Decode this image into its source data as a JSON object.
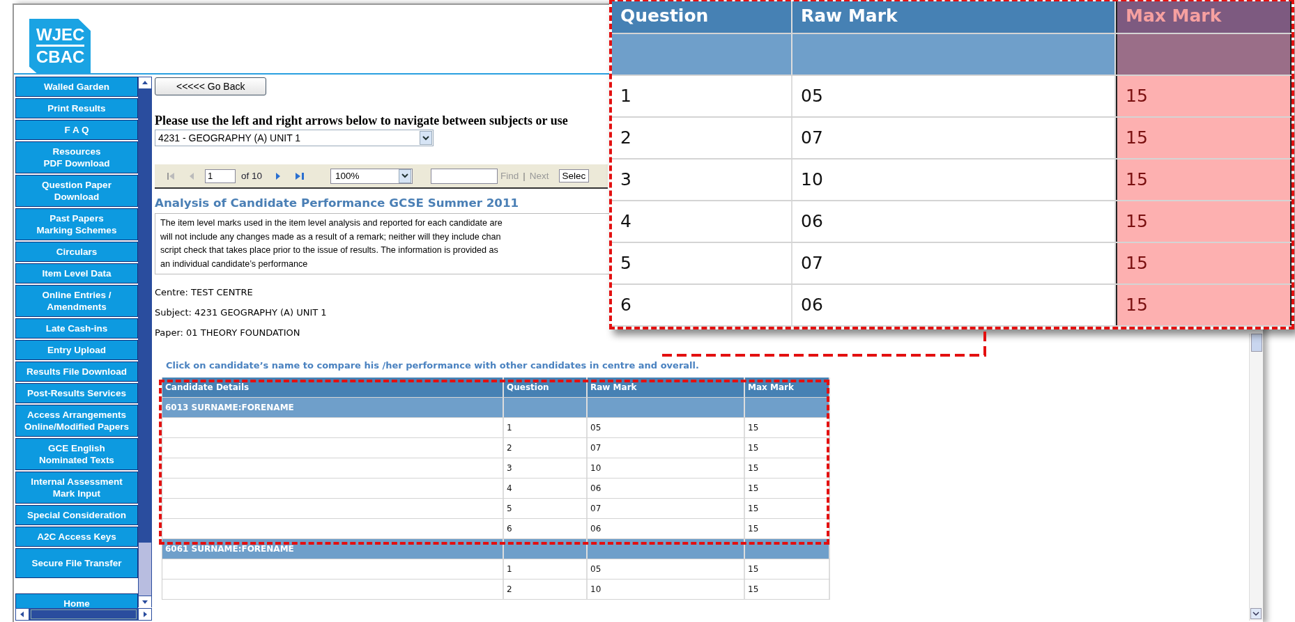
{
  "logo": {
    "lines": [
      "WJEC",
      "CBAC"
    ]
  },
  "sidebar": {
    "items": [
      {
        "label": "Walled Garden"
      },
      {
        "label": "Print Results"
      },
      {
        "label": "F A Q"
      },
      {
        "label": "Resources\nPDF Download"
      },
      {
        "label": "Question Paper\nDownload"
      },
      {
        "label": "Past Papers\nMarking Schemes"
      },
      {
        "label": "Circulars"
      },
      {
        "label": "Item Level Data"
      },
      {
        "label": "Online Entries /\nAmendments"
      },
      {
        "label": "Late Cash-ins"
      },
      {
        "label": "Entry Upload"
      },
      {
        "label": "Results File Download"
      },
      {
        "label": "Post-Results Services"
      },
      {
        "label": "Access Arrangements\nOnline/Modified Papers"
      },
      {
        "label": "GCE English\nNominated Texts"
      },
      {
        "label": "Internal Assessment\nMark Input"
      },
      {
        "label": "Special Consideration"
      },
      {
        "label": "A2C Access Keys"
      },
      {
        "label": "Secure File Transfer"
      },
      {
        "label": "Home"
      }
    ]
  },
  "go_back_button": "<<<<< Go Back",
  "instruction": "Please use the left and right arrows below to navigate between subjects or use",
  "subject_select": {
    "value": "4231 - GEOGRAPHY (A) UNIT 1"
  },
  "report_toolbar": {
    "page": "1",
    "page_count": "of 10",
    "zoom": "100%",
    "find": {
      "label": "Find",
      "disabled": true
    },
    "separator": "|",
    "next": {
      "label": "Next",
      "disabled": true
    },
    "export_select": "Selec"
  },
  "report": {
    "title": "Analysis of Candidate Performance GCSE Summer 2011",
    "notice_lines": [
      "The item level marks used in the item level analysis and reported for each candidate are",
      "will not include any changes made as a result of a remark; neither will they include chan",
      "script check that takes place prior to the issue of results. The information is provided as",
      "an individual candidate’s performance"
    ],
    "centre": "Centre: TEST CENTRE",
    "subject": "Subject: 4231 GEOGRAPHY (A) UNIT 1",
    "paper": "Paper: 01 THEORY FOUNDATION",
    "hint": "Click on candidate’s name to compare his /her performance with other candidates in centre and overall."
  },
  "table": {
    "columns": [
      "Candidate Details",
      "Question",
      "Raw Mark",
      "Max Mark"
    ],
    "groups": [
      {
        "candidate": "6013 SURNAME:FORENAME",
        "rows": [
          {
            "question": "1",
            "raw_mark": "05",
            "max_mark": "15"
          },
          {
            "question": "2",
            "raw_mark": "07",
            "max_mark": "15"
          },
          {
            "question": "3",
            "raw_mark": "10",
            "max_mark": "15"
          },
          {
            "question": "4",
            "raw_mark": "06",
            "max_mark": "15"
          },
          {
            "question": "5",
            "raw_mark": "07",
            "max_mark": "15"
          },
          {
            "question": "6",
            "raw_mark": "06",
            "max_mark": "15"
          }
        ]
      },
      {
        "candidate": "6061 SURNAME:FORENAME",
        "rows": [
          {
            "question": "1",
            "raw_mark": "05",
            "max_mark": "15"
          },
          {
            "question": "2",
            "raw_mark": "10",
            "max_mark": "15"
          }
        ]
      }
    ]
  },
  "callout": {
    "columns": [
      {
        "label": "Question",
        "highlighted": false
      },
      {
        "label": "Raw Mark",
        "highlighted": false
      },
      {
        "label": "Max Mark",
        "highlighted": true
      }
    ],
    "rows": [
      [
        "1",
        "05",
        "15"
      ],
      [
        "2",
        "07",
        "15"
      ],
      [
        "3",
        "10",
        "15"
      ],
      [
        "4",
        "06",
        "15"
      ],
      [
        "5",
        "07",
        "15"
      ],
      [
        "6",
        "06",
        "15"
      ]
    ]
  }
}
